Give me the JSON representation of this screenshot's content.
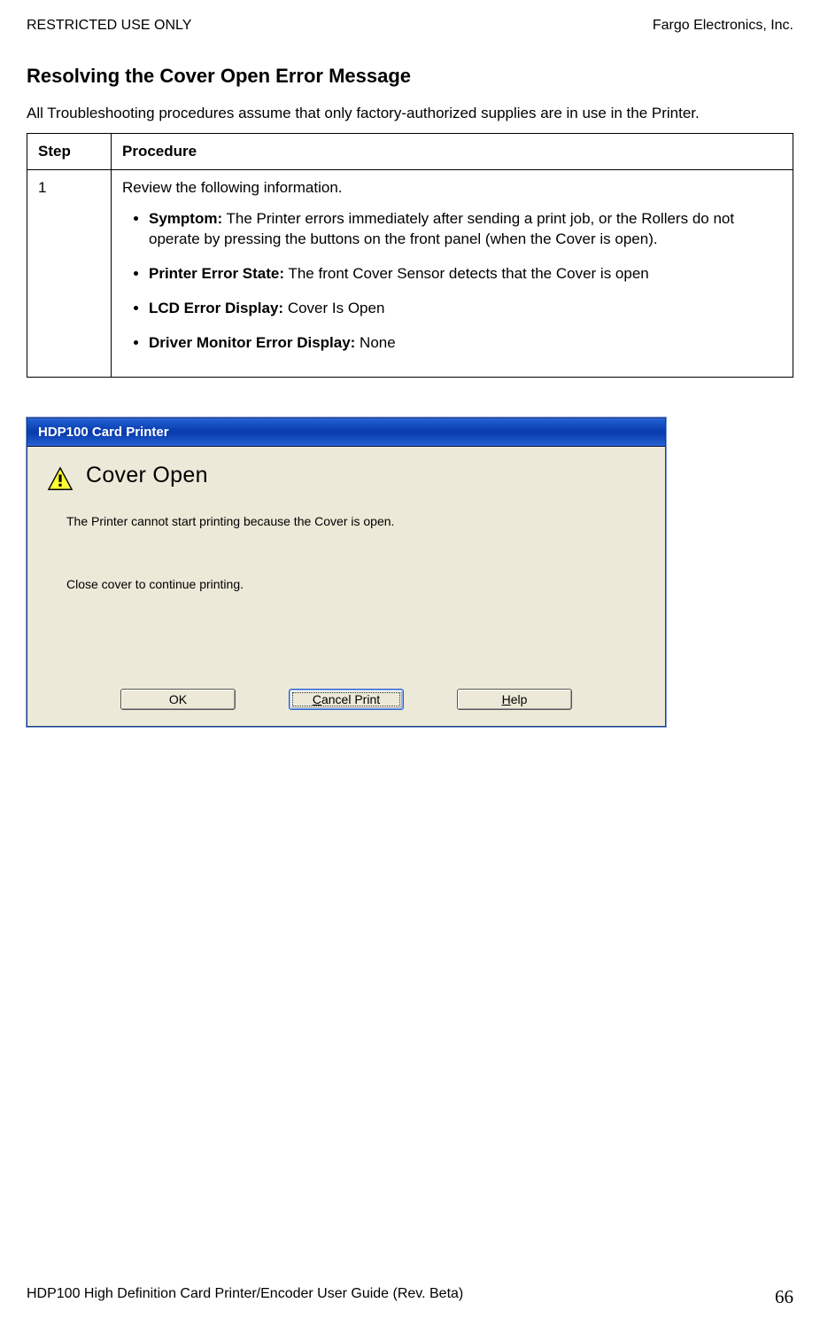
{
  "header": {
    "left": "RESTRICTED USE ONLY",
    "right": "Fargo Electronics, Inc."
  },
  "section_title": "Resolving the Cover Open Error Message",
  "intro": "All Troubleshooting procedures assume that only factory-authorized supplies are in use in the Printer.",
  "table": {
    "col_step": "Step",
    "col_procedure": "Procedure",
    "rows": [
      {
        "step": "1",
        "lead": "Review the following information.",
        "bullets": [
          {
            "label": "Symptom:",
            "text": " The Printer errors immediately after sending a print job, or the Rollers do not operate by pressing the buttons on the front panel (when the Cover is open)."
          },
          {
            "label": "Printer Error State:",
            "text": " The front Cover Sensor detects that the Cover is open"
          },
          {
            "label": "LCD Error Display:",
            "text": " Cover Is Open"
          },
          {
            "label": "Driver Monitor Error Display:",
            "text": " None"
          }
        ]
      }
    ]
  },
  "dialog": {
    "title": "HDP100 Card Printer",
    "heading": "Cover Open",
    "line1": "The Printer cannot start printing because the Cover is open.",
    "line2": "Close cover to continue printing.",
    "btn_ok": "OK",
    "btn_cancel_pre": "C",
    "btn_cancel_rest": "ancel Print",
    "btn_help_pre": "H",
    "btn_help_rest": "elp"
  },
  "footer": {
    "left": "HDP100 High Definition Card Printer/Encoder User Guide (Rev. Beta)",
    "page": "66"
  }
}
